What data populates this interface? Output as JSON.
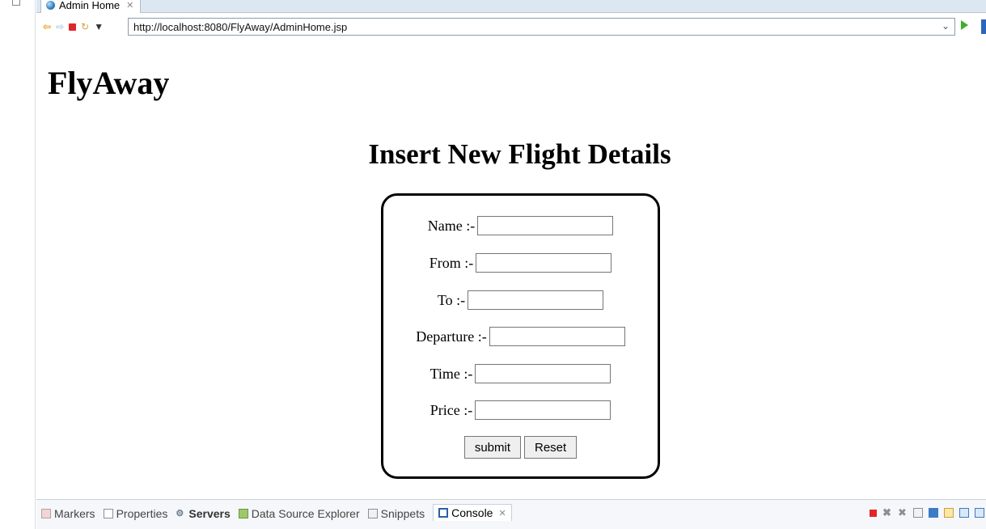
{
  "tab": {
    "title": "Admin Home",
    "close": "✕"
  },
  "toolbar": {
    "url": "http://localhost:8080/FlyAway/AdminHome.jsp"
  },
  "page": {
    "brand": "FlyAway",
    "heading": "Insert New Flight Details",
    "fields": [
      {
        "label": "Name :-",
        "value": ""
      },
      {
        "label": "From :-",
        "value": ""
      },
      {
        "label": "To :-",
        "value": ""
      },
      {
        "label": "Departure :-",
        "value": ""
      },
      {
        "label": "Time :-",
        "value": ""
      },
      {
        "label": "Price :-",
        "value": ""
      }
    ],
    "submit_label": "submit",
    "reset_label": "Reset"
  },
  "bottom_panel": {
    "tabs": [
      {
        "label": "Markers",
        "icon": "markers-icon"
      },
      {
        "label": "Properties",
        "icon": "properties-icon"
      },
      {
        "label": "Servers",
        "icon": "servers-icon"
      },
      {
        "label": "Data Source Explorer",
        "icon": "data-source-icon"
      },
      {
        "label": "Snippets",
        "icon": "snippets-icon"
      },
      {
        "label": "Console",
        "icon": "console-icon",
        "close": "✕"
      }
    ]
  },
  "colors": {
    "tabbar": "#dde7f2",
    "stop": "#e0262a",
    "go": "#3fae2a"
  }
}
